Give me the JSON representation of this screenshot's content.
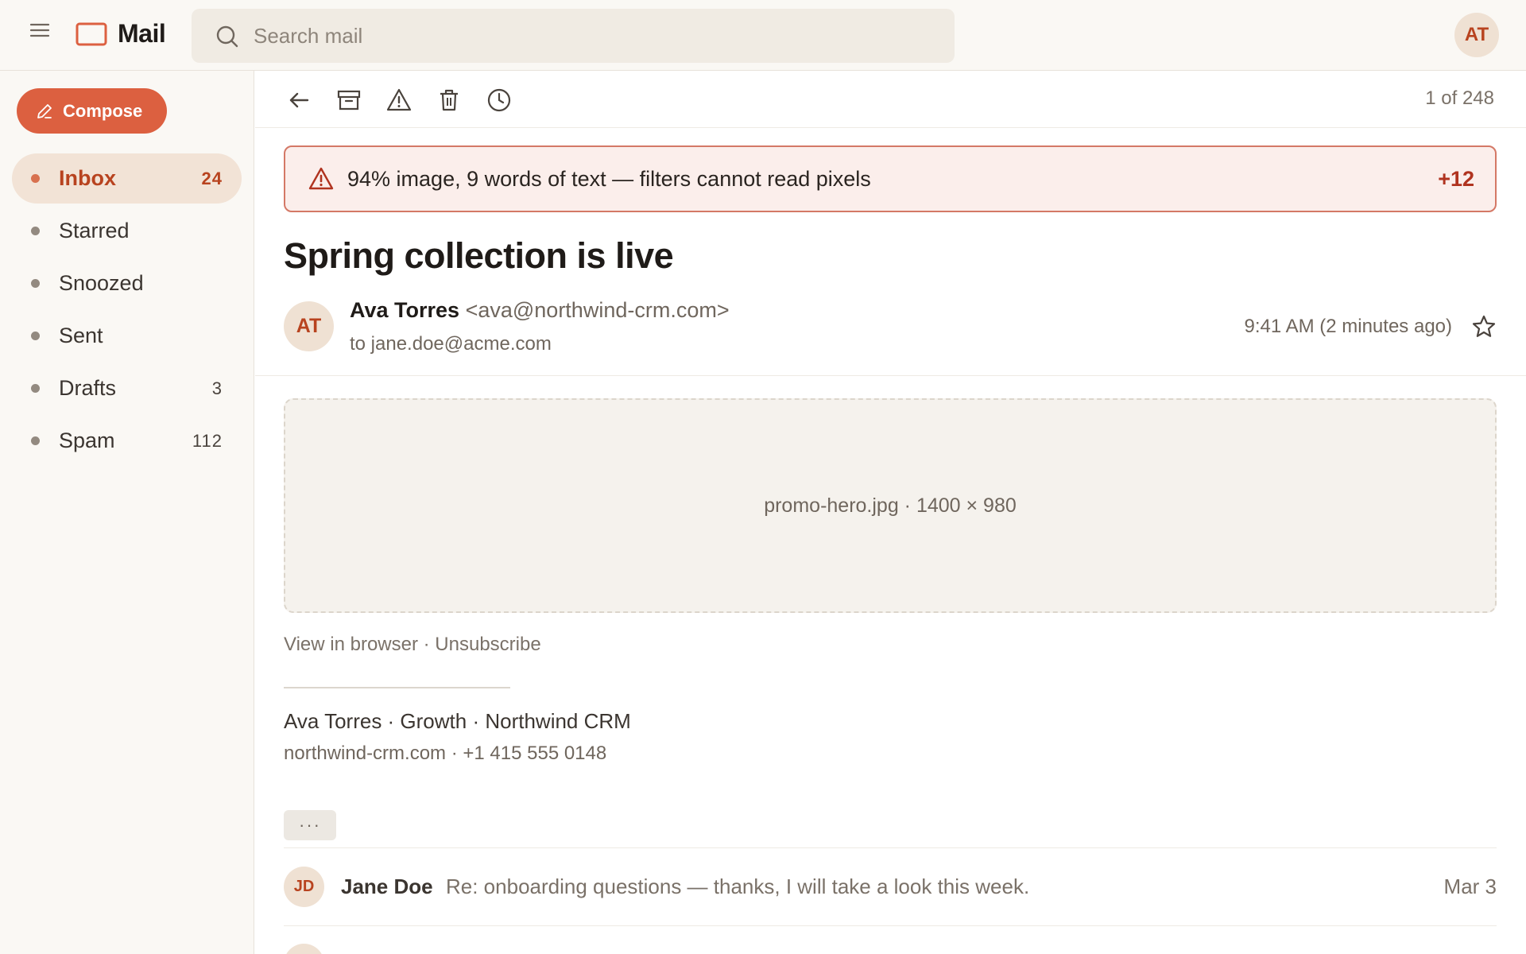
{
  "app": {
    "title": "Mail",
    "user_initials": "AT"
  },
  "search": {
    "placeholder": "Search mail",
    "value": ""
  },
  "sidebar": {
    "compose_label": "Compose",
    "items": [
      {
        "label": "Inbox",
        "count": "24",
        "active": true
      },
      {
        "label": "Starred",
        "count": ""
      },
      {
        "label": "Snoozed",
        "count": ""
      },
      {
        "label": "Sent",
        "count": ""
      },
      {
        "label": "Drafts",
        "count": "3"
      },
      {
        "label": "Spam",
        "count": "112"
      }
    ]
  },
  "toolbar": {
    "icons": [
      "back-arrow-icon",
      "archive-icon",
      "report-spam-icon",
      "trash-icon",
      "snooze-clock-icon"
    ],
    "pager": "1 of 248"
  },
  "warning": {
    "text": "94% image, 9 words of text — filters cannot read pixels",
    "score": "+12"
  },
  "message": {
    "subject": "Spring collection is live",
    "sender_initials": "AT",
    "sender_name": "Ava Torres",
    "sender_email": "<ava@northwind-crm.com>",
    "to": "to jane.doe@acme.com",
    "time": "9:41 AM (2 minutes ago)",
    "image_caption": "promo-hero.jpg · 1400 × 980",
    "links": {
      "view_in_browser": "View in browser",
      "separator": " · ",
      "unsubscribe": "Unsubscribe"
    },
    "signature": {
      "line1": "Ava Torres · Growth · Northwind CRM",
      "line2": "northwind-crm.com · +1 415 555 0148"
    },
    "expand_label": "···"
  },
  "thread": [
    {
      "initials": "JD",
      "name": "Jane Doe",
      "snippet": "Re: onboarding questions — thanks, I will take a look this week.",
      "date": "Mar 3"
    }
  ],
  "colors": {
    "accent": "#dc6040",
    "accent_text": "#b8431f",
    "warning_border": "#d47866",
    "warning_bg": "#fbeeeb",
    "sidebar_bg": "#faf8f4"
  }
}
